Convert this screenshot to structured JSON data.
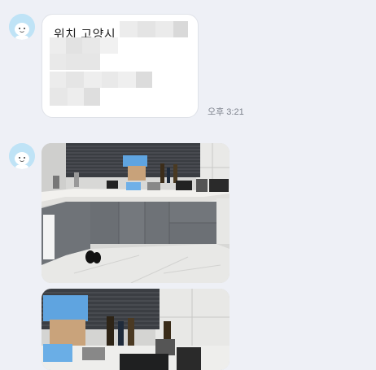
{
  "chat": {
    "messages": [
      {
        "type": "text",
        "text": "위치 고양시",
        "timestamp": "오후 3:21"
      },
      {
        "type": "image",
        "icon": "kitchen-photo"
      },
      {
        "type": "image",
        "icon": "kitchen-photo"
      }
    ]
  },
  "colors": {
    "background": "#eef0f6",
    "bubble": "#ffffff",
    "avatar": "#bfe3f6",
    "timestamp": "#7d828c"
  }
}
